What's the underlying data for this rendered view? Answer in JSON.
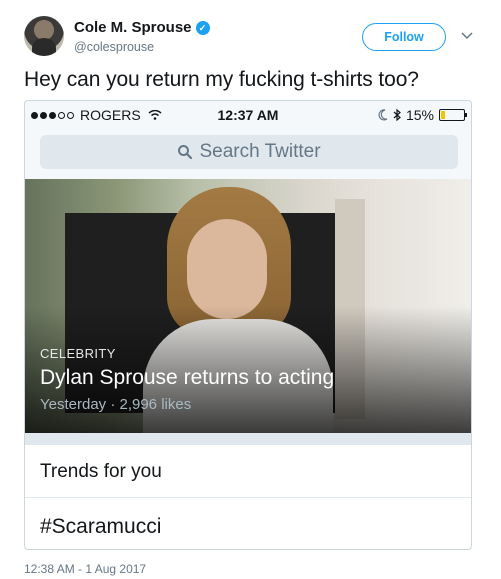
{
  "tweet": {
    "author_name": "Cole M. Sprouse",
    "handle": "@colesprouse",
    "follow_label": "Follow",
    "text": "Hey can you return my fucking t-shirts too?",
    "timestamp": "12:38 AM - 1 Aug 2017",
    "verified_icon": "✓"
  },
  "phone": {
    "carrier": "ROGERS",
    "time": "12:37 AM",
    "battery": "15%",
    "battery_level": 0.15,
    "search_placeholder": "Search Twitter",
    "card": {
      "category": "CELEBRITY",
      "title": "Dylan Sprouse returns to acting",
      "meta": "Yesterday · 2,996 likes"
    },
    "trends_title": "Trends for you",
    "trends": [
      "#Scaramucci"
    ]
  }
}
